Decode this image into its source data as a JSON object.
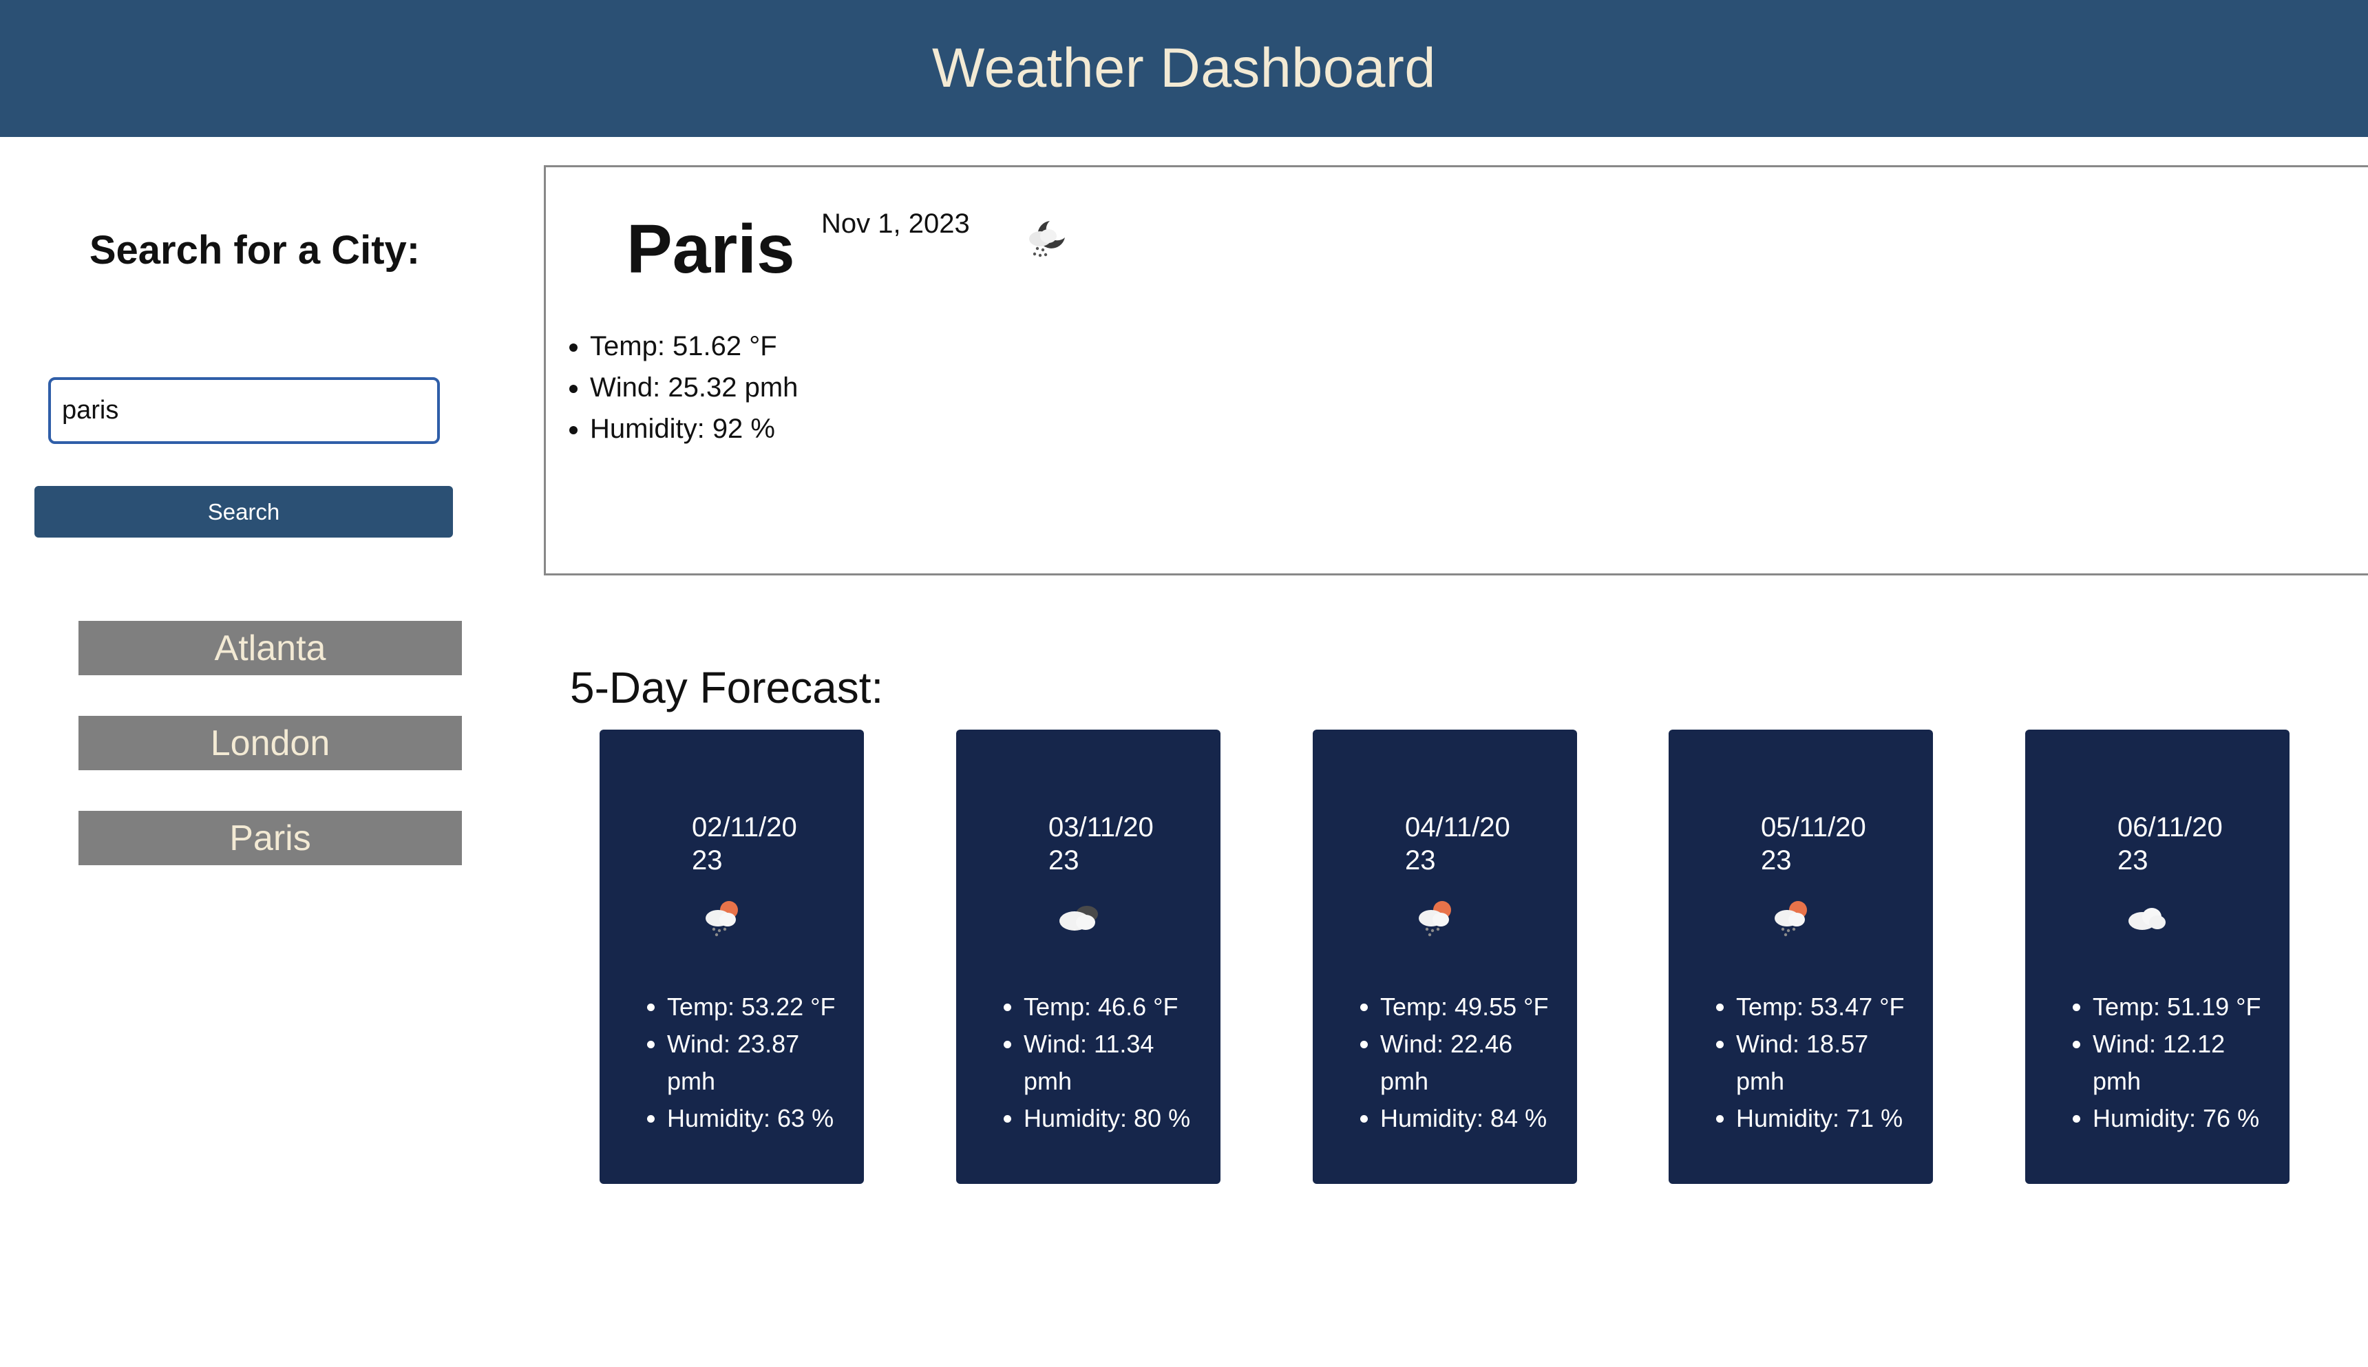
{
  "header": {
    "title": "Weather Dashboard"
  },
  "sidebar": {
    "title": "Search for a City:",
    "search_value": "paris",
    "search_button_label": "Search",
    "history": [
      "Atlanta",
      "London",
      "Paris"
    ]
  },
  "current": {
    "city": "Paris",
    "date": "Nov 1, 2023",
    "icon": "night-rain-cloud-icon",
    "temp": "Temp: 51.62 °F",
    "wind": "Wind: 25.32 pmh",
    "humidity": "Humidity: 92 %"
  },
  "forecast": {
    "title": "5-Day Forecast:",
    "days": [
      {
        "date": "02/11/2023",
        "icon": "sun-rain-cloud-icon",
        "temp": "Temp: 53.22 °F",
        "wind": "Wind: 23.87 pmh",
        "humidity": "Humidity: 63 %"
      },
      {
        "date": "03/11/2023",
        "icon": "dark-cloud-icon",
        "temp": "Temp: 46.6 °F",
        "wind": "Wind: 11.34 pmh",
        "humidity": "Humidity: 80 %"
      },
      {
        "date": "04/11/2023",
        "icon": "sun-rain-cloud-icon",
        "temp": "Temp: 49.55 °F",
        "wind": "Wind: 22.46 pmh",
        "humidity": "Humidity: 84 %"
      },
      {
        "date": "05/11/2023",
        "icon": "sun-rain-cloud-icon",
        "temp": "Temp: 53.47 °F",
        "wind": "Wind: 18.57 pmh",
        "humidity": "Humidity: 71 %"
      },
      {
        "date": "06/11/2023",
        "icon": "cloud-icon",
        "temp": "Temp: 51.19 °F",
        "wind": "Wind: 12.12 pmh",
        "humidity": "Humidity: 76 %"
      }
    ]
  },
  "colors": {
    "header_bg": "#2b5074",
    "header_text": "#f3ead4",
    "card_bg": "#16264b",
    "history_bg": "#7f7f7f"
  }
}
